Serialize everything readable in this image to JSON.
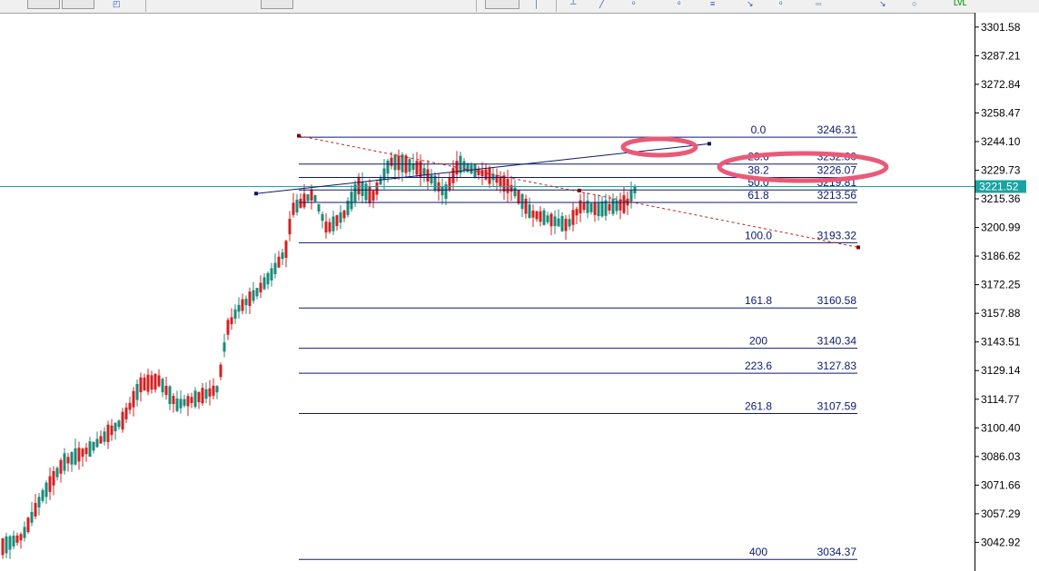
{
  "toolbar": {
    "icons": [
      "back-arrow-icon",
      "pointer-icon",
      "vertical-line-icon",
      "horizontal-line-icon",
      "trendline-icon",
      "fibonacci-icon",
      "channel-icon",
      "text-tool-icon",
      "arrow-icon",
      "shapes-icon",
      "zoom-icon"
    ],
    "level_badge": "LVL"
  },
  "colors": {
    "bull": "#d42020",
    "bear": "#1b8a7a",
    "fib_line": "#0c1a6e",
    "bid_line": "#1aa3a3",
    "trendline": "#0a1a6a",
    "dash_line": "#c81e1e",
    "highlight": "#e85a78",
    "price_label_bg": "#1aa3a3"
  },
  "price_axis": {
    "ticks": [
      "3301.58",
      "3287.21",
      "3272.84",
      "3258.47",
      "3244.10",
      "3229.73",
      "3215.36",
      "3200.99",
      "3186.62",
      "3172.25",
      "3157.88",
      "3143.51",
      "3129.14",
      "3114.77",
      "3100.40",
      "3086.03",
      "3071.66",
      "3057.29",
      "3042.92"
    ],
    "current_price": "3221.52"
  },
  "chart_data": {
    "type": "candlestick",
    "y_range": [
      3028.55,
      3308.77
    ],
    "current_price": 3221.52,
    "fibonacci": {
      "levels": [
        {
          "level": "0.0",
          "price": "3246.31"
        },
        {
          "level": "23.6",
          "price": "3232.80"
        },
        {
          "level": "38.2",
          "price": "3226.07"
        },
        {
          "level": "50.0",
          "price": "3219.81"
        },
        {
          "level": "61.8",
          "price": "3213.56"
        },
        {
          "level": "100.0",
          "price": "3193.32"
        },
        {
          "level": "161.8",
          "price": "3160.58"
        },
        {
          "level": "200",
          "price": "3140.34"
        },
        {
          "level": "223.6",
          "price": "3127.83"
        },
        {
          "level": "261.8",
          "price": "3107.59"
        },
        {
          "level": "400",
          "price": "3034.37"
        }
      ]
    },
    "trendline": {
      "from": 3218.0,
      "to": 3243.0
    },
    "dashed_trendline": {
      "from": 3247.0,
      "to": 3191.0
    }
  }
}
